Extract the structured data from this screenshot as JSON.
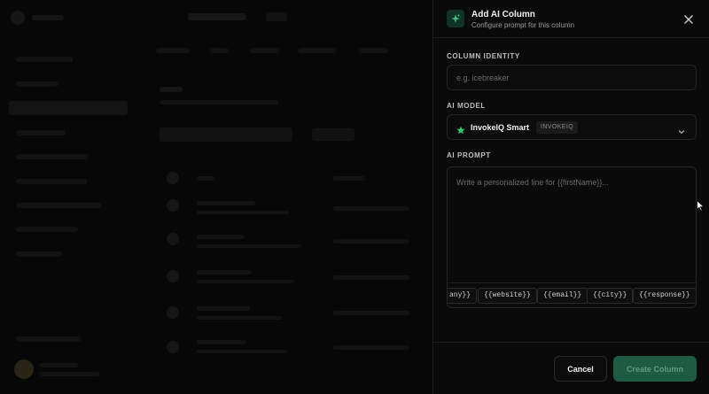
{
  "panel": {
    "title": "Add AI Column",
    "subtitle": "Configure prompt for this column",
    "close_icon": "close-icon",
    "header_icon": "sparkles-icon"
  },
  "column_identity": {
    "label": "COLUMN IDENTITY",
    "placeholder": "e.g. icebreaker",
    "value": ""
  },
  "ai_model": {
    "label": "AI MODEL",
    "selected_name": "InvokeIQ Smart",
    "selected_badge": "INVOKEIQ",
    "icon": "star-icon",
    "chevron": "chevron-down-icon"
  },
  "ai_prompt": {
    "label": "AI PROMPT",
    "placeholder": "Write a personalized line for {{firstName}}...",
    "variables": [
      "any}}",
      "{{website}}",
      "{{email}}",
      "{{city}}",
      "{{response}}"
    ]
  },
  "footer": {
    "cancel_label": "Cancel",
    "create_label": "Create Column"
  },
  "colors": {
    "accent": "#1e5b43",
    "accent_text": "#5c9c7f",
    "header_icon_bg": "#0f3326",
    "star": "#2ecc71"
  }
}
